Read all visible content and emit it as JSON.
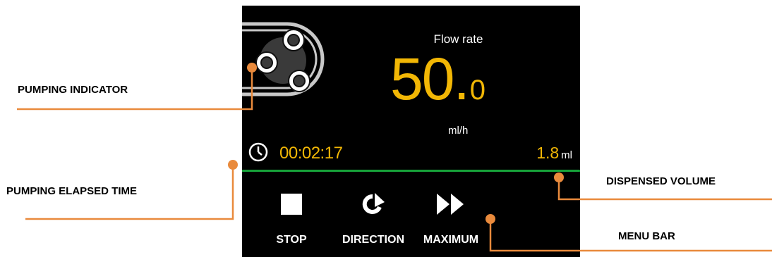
{
  "callouts": {
    "pumping_indicator": "PUMPING INDICATOR",
    "pumping_elapsed_time": "PUMPING ELAPSED TIME",
    "dispensed_volume": "DISPENSED VOLUME",
    "menu_bar": "MENU BAR"
  },
  "display": {
    "flow_rate_label": "Flow rate",
    "flow_rate_int": "50",
    "flow_rate_dot": ".",
    "flow_rate_dec": "0",
    "flow_rate_unit": "ml/h",
    "elapsed_time": "00:02:17",
    "volume_value": "1.8",
    "volume_unit": "ml"
  },
  "menu": {
    "stop_label": "STOP",
    "direction_label": "DIRECTION",
    "maximum_label": "MAXIMUM"
  },
  "colors": {
    "accent": "#f2b705",
    "callout_line": "#e98a3c",
    "divider": "#17a33a",
    "screen_bg": "#000000"
  },
  "icons": {
    "pump": "peristaltic-pump-icon",
    "clock": "clock-icon",
    "stop": "stop-square-icon",
    "direction": "rotate-arrow-icon",
    "maximum": "fast-forward-icon"
  }
}
